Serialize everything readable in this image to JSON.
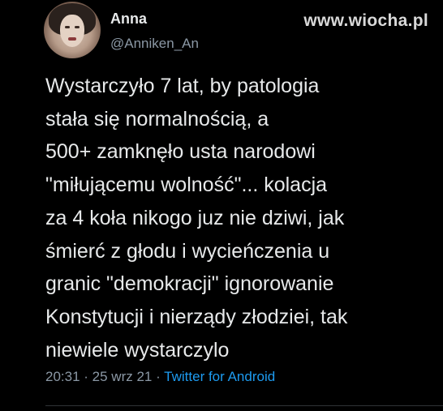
{
  "watermark": "www.wiocha.pl",
  "author": {
    "display_name": "Anna",
    "handle": "@Anniken_An"
  },
  "tweet": {
    "lines": [
      "Wystarczyło 7 lat, by patologia",
      "stała się normalnością, a",
      "500+ zamknęło usta narodowi",
      "\"miłującemu wolność\"... kolacja",
      "za 4 koła nikogo juz nie dziwi, jak",
      "śmierć z głodu i wycieńczenia u",
      "granic \"demokracji\" ignorowanie",
      "Konstytucji i nierządy złodziei, tak",
      "niewiele wystarczylo"
    ],
    "time": "20:31",
    "separator": " · ",
    "date": "25 wrz 21",
    "source": "Twitter for Android"
  },
  "colors": {
    "background": "#000000",
    "text": "#e7e9ea",
    "secondary": "#8b98a5",
    "link": "#1d9bf0"
  }
}
